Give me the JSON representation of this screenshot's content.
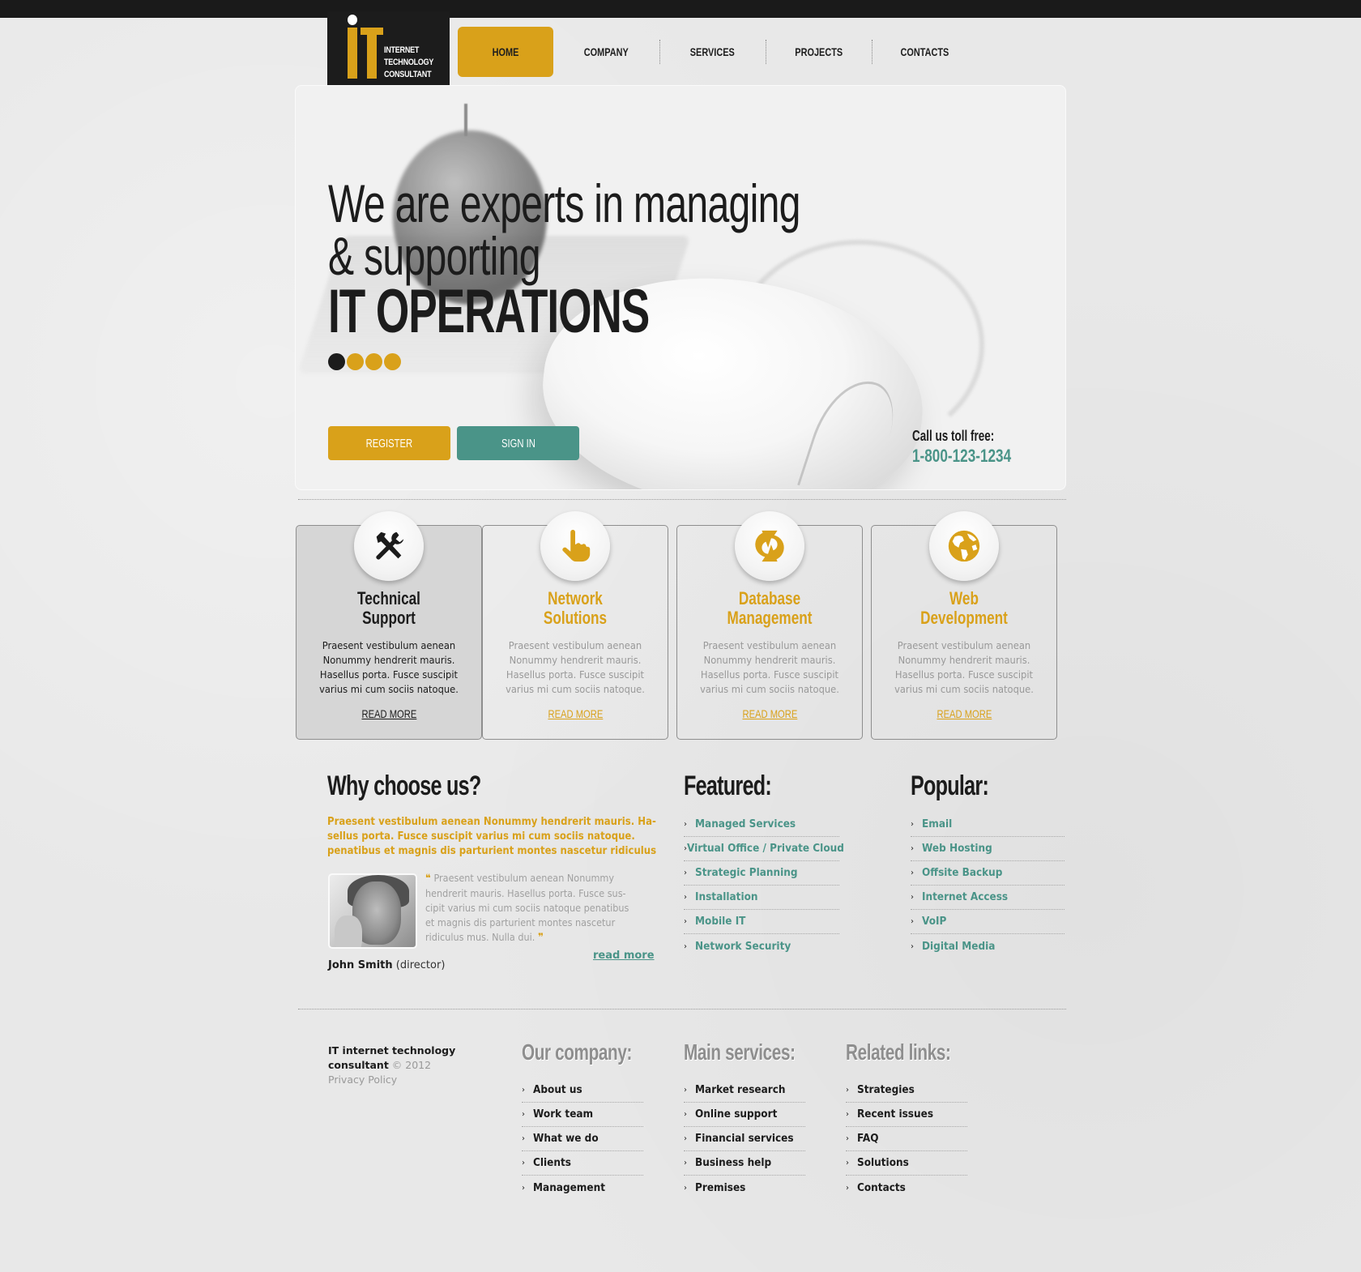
{
  "logo": {
    "letters": "IT",
    "lines": [
      "INTERNET",
      "TECHNOLOGY",
      "CONSULTANT"
    ]
  },
  "nav": {
    "items": [
      {
        "label": "HOME",
        "active": true
      },
      {
        "label": "COMPANY"
      },
      {
        "label": "SERVICES"
      },
      {
        "label": "PROJECTS"
      },
      {
        "label": "CONTACTS"
      }
    ]
  },
  "hero": {
    "line1": "We are experts in managing",
    "line2": "& supporting",
    "line3": "IT OPERATIONS",
    "slides_total": 4,
    "active_slide": 1,
    "register_label": "REGISTER",
    "signin_label": "SIGN IN",
    "call_label": "Call us toll free:",
    "phone": "1-800-123-1234"
  },
  "services": [
    {
      "icon": "tools-icon",
      "title": [
        "Technical",
        "Support"
      ],
      "desc": [
        "Praesent vestibulum aenean",
        "Nonummy hendrerit mauris.",
        "Hasellus porta. Fusce suscipit",
        "varius mi cum sociis natoque."
      ],
      "more": "READ MORE",
      "active": true
    },
    {
      "icon": "pointer-hand-icon",
      "title": [
        "Network",
        "Solutions"
      ],
      "desc": [
        "Praesent vestibulum aenean",
        "Nonummy hendrerit mauris.",
        "Hasellus porta. Fusce suscipit",
        "varius mi cum sociis natoque."
      ],
      "more": "READ MORE"
    },
    {
      "icon": "sync-icon",
      "title": [
        "Database",
        "Management"
      ],
      "desc": [
        "Praesent vestibulum aenean",
        "Nonummy hendrerit mauris.",
        "Hasellus porta. Fusce suscipit",
        "varius mi cum sociis natoque."
      ],
      "more": "READ MORE"
    },
    {
      "icon": "globe-icon",
      "title": [
        "Web",
        "Development"
      ],
      "desc": [
        "Praesent vestibulum aenean",
        "Nonummy hendrerit mauris.",
        "Hasellus porta. Fusce suscipit",
        "varius mi cum sociis natoque."
      ],
      "more": "READ MORE"
    }
  ],
  "why": {
    "heading": "Why choose us?",
    "lead": [
      "Praesent vestibulum aenean Nonummy hendrerit mauris. Ha-",
      "sellus porta. Fusce suscipit varius mi cum sociis natoque.",
      "penatibus et magnis dis parturient montes nascetur ridiculus"
    ],
    "quote_open": "❝",
    "quote": [
      "Praesent vestibulum aenean Nonummy",
      "hendrerit mauris. Hasellus porta. Fusce sus-",
      "cipit varius mi cum sociis natoque penatibus",
      "et magnis dis parturient montes nascetur",
      "ridiculus mus. Nulla dui."
    ],
    "quote_close": "❞",
    "read_more": "read more",
    "author_name": "John Smith",
    "author_role": "(director)"
  },
  "featured": {
    "heading": "Featured:",
    "items": [
      "Managed Services",
      "Virtual Office / Private Cloud",
      "Strategic Planning",
      "Installation",
      "Mobile IT",
      "Network Security"
    ]
  },
  "popular": {
    "heading": "Popular:",
    "items": [
      "Email",
      "Web Hosting",
      "Offsite Backup",
      "Internet Access",
      "VoIP",
      "Digital Media"
    ]
  },
  "footer": {
    "company_line1": "IT internet technology",
    "company_line2": "consultant",
    "copyright": "© 2012",
    "privacy": "Privacy Policy",
    "columns": [
      {
        "heading": "Our company:",
        "items": [
          "About us",
          "Work team",
          "What we do",
          "Clients",
          "Management"
        ]
      },
      {
        "heading": "Main services:",
        "items": [
          "Market research",
          "Online support",
          "Financial services",
          "Business help",
          "Premises"
        ]
      },
      {
        "heading": "Related links:",
        "items": [
          "Strategies",
          "Recent issues",
          "FAQ",
          "Solutions",
          "Contacts"
        ]
      }
    ]
  },
  "colors": {
    "accent": "#d9a11a",
    "teal": "#4a9488",
    "dark": "#1c1c1c",
    "background": "#e8e8e8"
  }
}
